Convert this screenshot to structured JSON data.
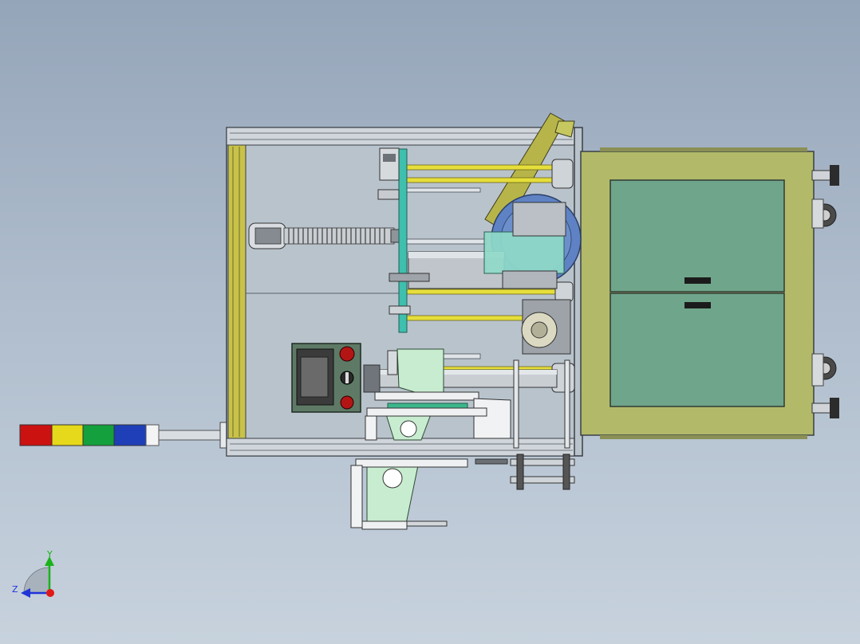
{
  "viewport": {
    "background_top": "#95a5b9",
    "background_bottom": "#c7d2dd"
  },
  "triad": {
    "y_label": "Y",
    "z_label": "Z",
    "y_color": "#19b319",
    "z_color": "#2034d8",
    "x_color": "#e01818"
  },
  "model": {
    "stack_light_colors": [
      "#cc1111",
      "#e6d81a",
      "#14a03c",
      "#1f3fb8"
    ],
    "frame_color": "#c4cace",
    "rail_color": "#c8c24a",
    "cabinet_color": "#b2ba6a",
    "door_color": "#6fa58a",
    "glass_color": "#8fd9c8",
    "blade_color": "#b7b54a"
  }
}
